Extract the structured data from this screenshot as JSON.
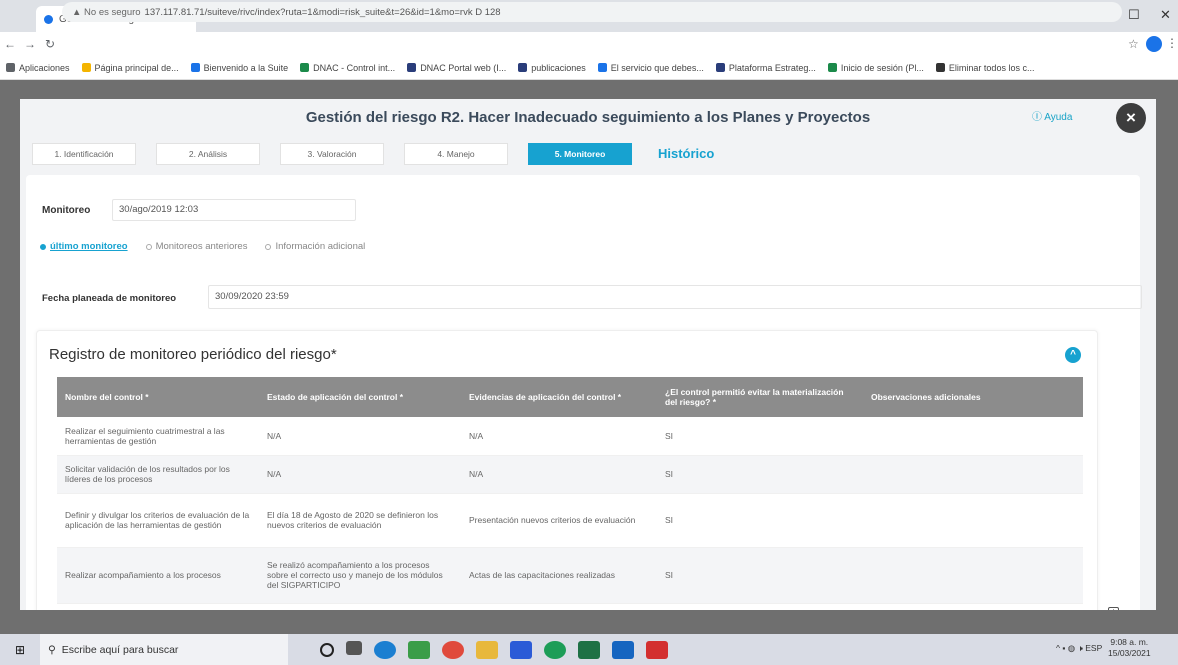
{
  "browser": {
    "tab_title": "Gestión del riesgo - Suite Visió...",
    "tab_close": "×",
    "new_tab": "+",
    "url_warning": "▲ No es seguro",
    "url": "137.117.81.71/suiteve/rivc/index?ruta=1&modi=risk_suite&t=26&id=1&mo=rvk D 128",
    "bookmarks": [
      {
        "label": "Aplicaciones",
        "color": "#5f6368"
      },
      {
        "label": "Página principal de...",
        "color": "#f4b400"
      },
      {
        "label": "Bienvenido a la Suite",
        "color": "#1a73e8"
      },
      {
        "label": "DNAC - Control int...",
        "color": "#1b8a4a"
      },
      {
        "label": "DNAC Portal web (I...",
        "color": "#2a3d7a"
      },
      {
        "label": "publicaciones",
        "color": "#2a3d7a"
      },
      {
        "label": "El servicio que debes...",
        "color": "#1a73e8"
      },
      {
        "label": "Plataforma Estrateg...",
        "color": "#2a3d7a"
      },
      {
        "label": "Inicio de sesión (Pl...",
        "color": "#1b8a4a"
      },
      {
        "label": "Eliminar todos los c...",
        "color": "#333"
      }
    ]
  },
  "modal": {
    "title": "Gestión del riesgo R2. Hacer Inadecuado seguimiento a los Planes y Proyectos",
    "help": "Ⓘ Ayuda",
    "close": "×",
    "steps": [
      {
        "label": "1. Identificación",
        "active": false
      },
      {
        "label": "2. Análisis",
        "active": false
      },
      {
        "label": "3. Valoración",
        "active": false
      },
      {
        "label": "4. Manejo",
        "active": false
      },
      {
        "label": "5. Monitoreo",
        "active": true
      }
    ],
    "historico": "Histórico",
    "monitoreo_label": "Monitoreo",
    "monitoreo_value": "30/ago/2019 12:03",
    "subtabs": [
      {
        "label": "último monitoreo",
        "active": true
      },
      {
        "label": "Monitoreos anteriores",
        "active": false
      },
      {
        "label": "Información adicional",
        "active": false
      }
    ],
    "fecha_label": "Fecha planeada de monitoreo",
    "fecha_value": "30/09/2020 23:59",
    "registro_title": "Registro de monitoreo periódico del riesgo*",
    "collapse_icon": "^",
    "table": {
      "headers": [
        "Nombre del control *",
        "Estado de aplicación del control *",
        "Evidencias de aplicación del control *",
        "¿El control permitió evitar la materialización del riesgo? *",
        "Observaciones adicionales"
      ],
      "rows": [
        [
          "Realizar el seguimiento cuatrimestral a las herramientas de gestión",
          "N/A",
          "N/A",
          "SI",
          ""
        ],
        [
          "Solicitar validación de los resultados por los líderes de los procesos",
          "N/A",
          "N/A",
          "SI",
          ""
        ],
        [
          "Definir y divulgar los criterios de evaluación de la aplicación de las herramientas de gestión",
          "El día 18 de Agosto de 2020 se definieron los nuevos criterios de evaluación",
          "Presentación nuevos criterios de evaluación",
          "SI",
          ""
        ],
        [
          "Realizar acompañamiento a los procesos",
          "Se realizó acompañamiento a los procesos sobre el correcto uso y manejo de los módulos del SIGPARTICIPO",
          "Actas de las capacitaciones realizadas",
          "SI",
          ""
        ]
      ]
    }
  },
  "taskbar": {
    "search_placeholder": "Escribe aquí para buscar",
    "time": "9:08 a. m.",
    "date": "15/03/2021",
    "tray": "ESP"
  }
}
